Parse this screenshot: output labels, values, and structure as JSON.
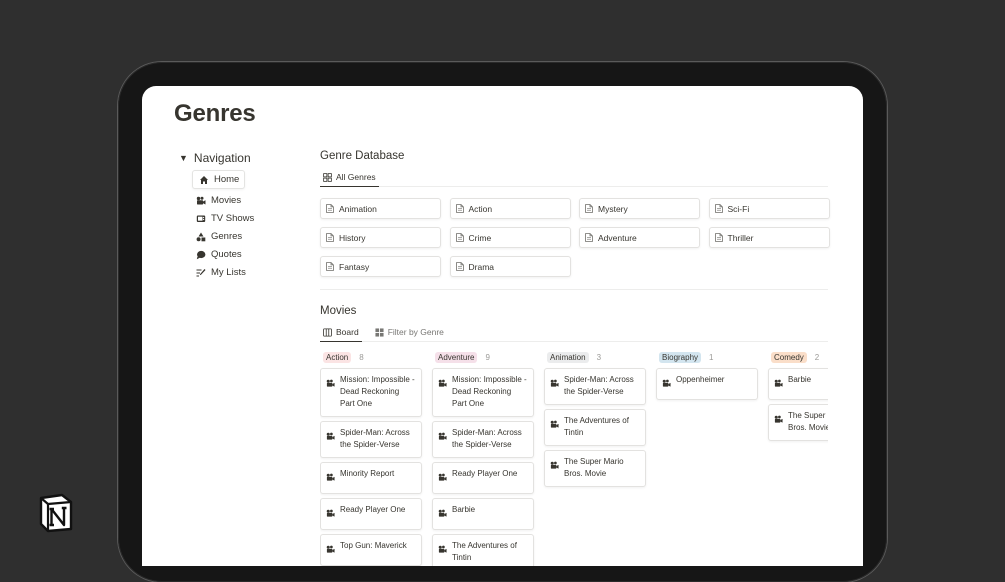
{
  "page": {
    "title": "Genres"
  },
  "navigation": {
    "title": "Navigation",
    "items": [
      {
        "label": "Home",
        "icon": "home-icon"
      },
      {
        "label": "Movies",
        "icon": "film-camera-icon"
      },
      {
        "label": "TV Shows",
        "icon": "tv-icon"
      },
      {
        "label": "Genres",
        "icon": "shapes-icon"
      },
      {
        "label": "Quotes",
        "icon": "speech-bubble-icon"
      },
      {
        "label": "My Lists",
        "icon": "list-pencil-icon"
      }
    ]
  },
  "genre_database": {
    "title": "Genre Database",
    "tab": "All Genres",
    "genres": [
      "Animation",
      "Action",
      "Mystery",
      "Sci-Fi",
      "History",
      "Crime",
      "Adventure",
      "Thriller",
      "Fantasy",
      "Drama"
    ]
  },
  "movies": {
    "title": "Movies",
    "tabs": [
      "Board",
      "Filter by Genre"
    ],
    "columns": [
      {
        "name": "Action",
        "count": "8",
        "color": "#fbe4e4",
        "cards": [
          "Mission: Impossible - Dead Reckoning Part One",
          "Spider-Man: Across the Spider-Verse",
          "Minority Report",
          "Ready Player One",
          "Top Gun: Maverick",
          "The Adventures of Tintin"
        ]
      },
      {
        "name": "Adventure",
        "count": "9",
        "color": "#f5e0e9",
        "cards": [
          "Mission: Impossible - Dead Reckoning Part One",
          "Spider-Man: Across the Spider-Verse",
          "Ready Player One",
          "Barbie",
          "The Adventures of Tintin"
        ]
      },
      {
        "name": "Animation",
        "count": "3",
        "color": "#ebeced",
        "cards": [
          "Spider-Man: Across the Spider-Verse",
          "The Adventures of Tintin",
          "The Super Mario Bros. Movie"
        ]
      },
      {
        "name": "Biography",
        "count": "1",
        "color": "#d3e5ef",
        "cards": [
          "Oppenheimer"
        ]
      },
      {
        "name": "Comedy",
        "count": "2",
        "color": "#fadec9",
        "cards": [
          "Barbie",
          "The Super Mario Bros. Movie"
        ]
      }
    ]
  }
}
